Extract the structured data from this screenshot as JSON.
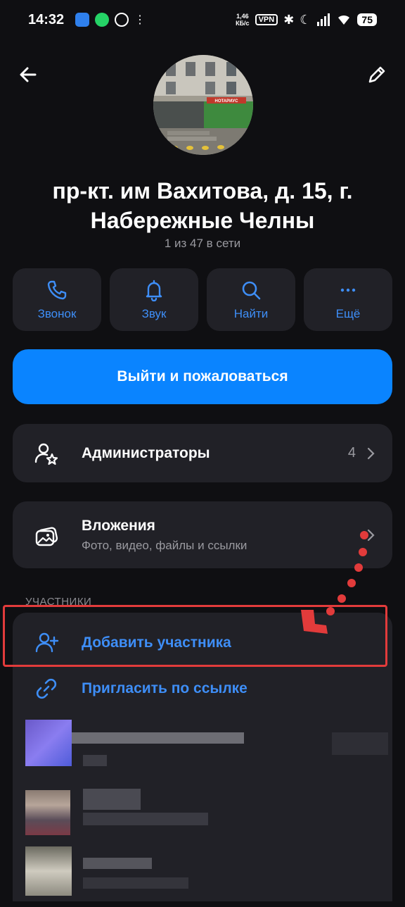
{
  "status_bar": {
    "time": "14:32",
    "speed_top": "1,46",
    "speed_bottom": "КБ/с",
    "vpn": "VPN",
    "battery": "75"
  },
  "header": {
    "back_icon": "arrow-left-icon",
    "edit_icon": "pencil-icon"
  },
  "group": {
    "title": "пр-кт. им Вахитова, д. 15, г. Набережные Челны",
    "online_status": "1 из 47 в сети",
    "avatar_sign": "НОТАРИУС"
  },
  "actions": [
    {
      "label": "Звонок",
      "icon": "phone-icon"
    },
    {
      "label": "Звук",
      "icon": "bell-icon"
    },
    {
      "label": "Найти",
      "icon": "search-icon"
    },
    {
      "label": "Ещё",
      "icon": "more-icon"
    }
  ],
  "leave_button": {
    "label": "Выйти и пожаловаться"
  },
  "admins": {
    "label": "Администраторы",
    "count": "4"
  },
  "attachments": {
    "title": "Вложения",
    "subtitle": "Фото, видео, файлы и ссылки"
  },
  "members_section": {
    "label": "УЧАСТНИКИ",
    "add_member": "Добавить участника",
    "invite_link": "Пригласить по ссылке"
  },
  "colors": {
    "accent": "#3e8ef7",
    "primary_button": "#0a84ff",
    "card": "#212127",
    "background": "#0f0f12",
    "annotation": "#e23b3b"
  }
}
